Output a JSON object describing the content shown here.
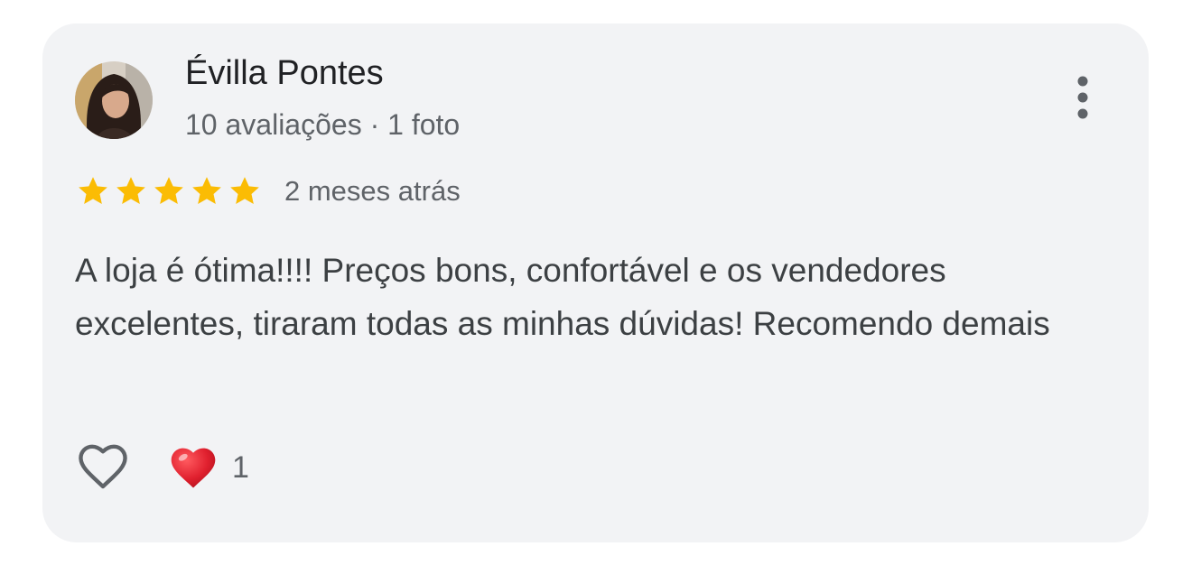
{
  "review": {
    "author_name": "Évilla Pontes",
    "author_meta": "10 avaliações · 1 foto",
    "rating": 5,
    "rating_max": 5,
    "time_ago": "2 meses atrás",
    "text": "A loja é ótima!!!! Preços bons, confortável e os vendedores excelentes, tiraram todas as minhas dúvidas! Recomendo demais",
    "reaction_count": "1"
  },
  "icons": {
    "menu": "more-vertical-icon",
    "like": "heart-outline-icon",
    "reaction": "red-heart-emoji-icon",
    "star": "star-icon"
  },
  "colors": {
    "card_background": "#f2f3f5",
    "star": "#fbbc04",
    "heart_reaction": "#e0202e",
    "text_primary": "#202124",
    "text_secondary": "#5f6368"
  }
}
